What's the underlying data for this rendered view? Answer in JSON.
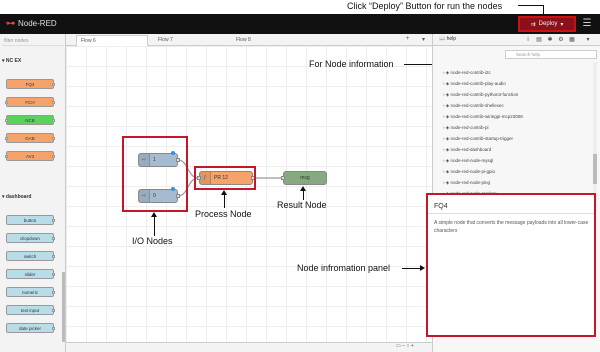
{
  "annotations": {
    "deploy_note": "Click “Deploy” Button for run the nodes",
    "node_info": "For Node information",
    "process_node": "Process Node",
    "result_node": "Result Node",
    "io_nodes": "I/O Nodes",
    "info_panel": "Node infromation panel"
  },
  "header": {
    "app_title": "Node-RED",
    "deploy_label": "Deploy",
    "menu_icon": "hamburger-icon"
  },
  "palette": {
    "filter_placeholder": "filter nodes",
    "categories": [
      {
        "label": "NC EX",
        "nodes": [
          {
            "label": "FQ4",
            "color": "#f5a36a"
          },
          {
            "label": "FCH",
            "color": "#f5a36a"
          },
          {
            "label": "NCB",
            "color": "#59d35b"
          },
          {
            "label": "GAB",
            "color": "#f5a36a"
          },
          {
            "label": "AV3",
            "color": "#f5a36a"
          }
        ]
      },
      {
        "label": "dashboard",
        "nodes": [
          {
            "label": "button",
            "color": "#b8dce8"
          },
          {
            "label": "dropdown",
            "color": "#b8dce8"
          },
          {
            "label": "switch",
            "color": "#b8dce8"
          },
          {
            "label": "slider",
            "color": "#b8dce8"
          },
          {
            "label": "numeric",
            "color": "#b8dce8"
          },
          {
            "label": "text input",
            "color": "#b8dce8"
          },
          {
            "label": "date picker",
            "color": "#b8dce8"
          }
        ]
      }
    ]
  },
  "tabs": [
    {
      "label": "Flow 6",
      "active": true
    },
    {
      "label": "Flow 7",
      "active": false
    },
    {
      "label": "Flow 8",
      "active": false
    }
  ],
  "flow": {
    "input1_label": "1",
    "input2_label": "0",
    "process_label": "PR 12",
    "result_label": "msg",
    "input_color": "#a6bbcf",
    "process_color": "#f5a36a",
    "result_color": "#87a980"
  },
  "sidebar": {
    "tab_label": "help",
    "search_placeholder": "Search help",
    "modules": [
      "node-red-contrib-i2c",
      "node-red-contrib-play-audio",
      "node-red-contrib-python3-function",
      "node-red-contrib-shellexec",
      "node-red-contrib-wiringpi-mcp23008",
      "node-red-contrib-pi",
      "node-red-contrib-startup-trigger",
      "node-red-dashboard",
      "node-red-node-mysql",
      "node-red-node-pi-gpio",
      "node-red-node-ping",
      "node-red-node-random"
    ],
    "info_title": "FQ4",
    "info_desc": "A simple node that converts the message payloads into all lower-case characters"
  },
  "accent": "#c5162a"
}
